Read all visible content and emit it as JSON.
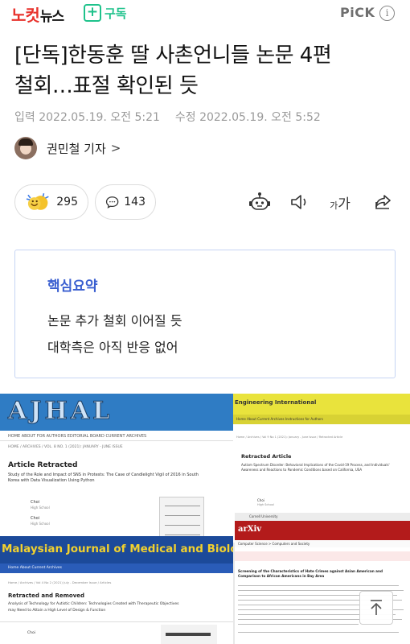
{
  "header": {
    "brand_red": "노컷",
    "brand_black": "뉴스",
    "subscribe_label": "구독",
    "pick_label": "PiCK",
    "info_icon": "i"
  },
  "article": {
    "headline_line1": "[단독]한동훈 딸 사촌언니들 논문 4편",
    "headline_line2": "철회…표절 확인된 듯",
    "input_label": "입력",
    "input_time": "2022.05.19. 오전 5:21",
    "modified_label": "수정",
    "modified_time": "2022.05.19. 오전 5:52",
    "reporter": "권민철 기자",
    "reporter_chevron": ">"
  },
  "actions": {
    "like_count": "295",
    "comment_count": "143",
    "font_small": "가",
    "font_large": "가"
  },
  "summary": {
    "title": "핵심요약",
    "line1": "논문 추가 철회 이어질 듯",
    "line2": "대학측은 아직 반응 없어"
  },
  "photo": {
    "ajhal": {
      "logo": "AJHAL",
      "nav": "HOME   ABOUT   FOR AUTHORS   EDITORIAL BOARD   CURRENT   ARCHIVES",
      "crumb": "HOME / ARCHIVES / VOL. 8 NO. 1 (2021): JANUARY - JUNE ISSUE",
      "heading": "Article Retracted",
      "abstract1": "Study of the Role and Impact of SNS in Protests: The Case of Candlelight Vigil of 2016 in South",
      "abstract2": "Korea with Data Visualization Using Python",
      "author1": "Choi",
      "author1_school": "High School",
      "author2": "Choi",
      "author2_school": "High School"
    },
    "eng": {
      "title": "Engineering International",
      "nav": "Home   About   Current   Archives   Instructions for Authors",
      "crumb": "Home / Archives / Vol 9 No 1 (2021): January - June Issue / Retracted Article",
      "heading": "Retracted Article",
      "abstract1": "Autism Spectrum Disorder: Behavioral Implications of the Covid-19 Process, and Individuals'",
      "abstract2": "Awareness and Reactions to Pandemic Conditions based on California, USA",
      "author": "Choi",
      "author_school": "High School"
    },
    "arxiv": {
      "header": "Cornell University",
      "logo": "arXiv",
      "section": "Computer Science > Computers and Society",
      "title1": "Screening of the Characteristics of Hate Crimes against Asian American and",
      "title2": "Comparison to African Americans in Bay Area"
    },
    "malaysian": {
      "title": "Malaysian Journal of Medical and Biolog",
      "nav": "Home   About   Current   Archives",
      "crumb": "Home / Archives / Vol 4 No 2 (2021) July - December Issue / Articles",
      "heading": "Retracted and Removed",
      "abstract1": "Analysis of Technology for Autistic Children: Technologies Created with Therapeutic Objectives",
      "abstract2": "may Need to Attain a High Level of Design & Function",
      "author": "Choi"
    }
  },
  "colors": {
    "brand_red": "#e8322c",
    "subscribe_green": "#1ec28b",
    "summary_blue": "#3a5fd0",
    "summary_border": "#c6d4f3",
    "ajhal_blue": "#2f7cc4",
    "eng_yellow": "#e9e33c",
    "arxiv_red": "#b31b1b",
    "malaysian_blue": "#1c4a9a",
    "malaysian_text": "#f2d12e"
  },
  "icons": [
    "plus-icon",
    "info-icon",
    "chevron-right-icon",
    "clap-icon",
    "comment-icon",
    "robot-icon",
    "speaker-icon",
    "font-size-icon",
    "share-icon",
    "arrow-up-icon"
  ]
}
